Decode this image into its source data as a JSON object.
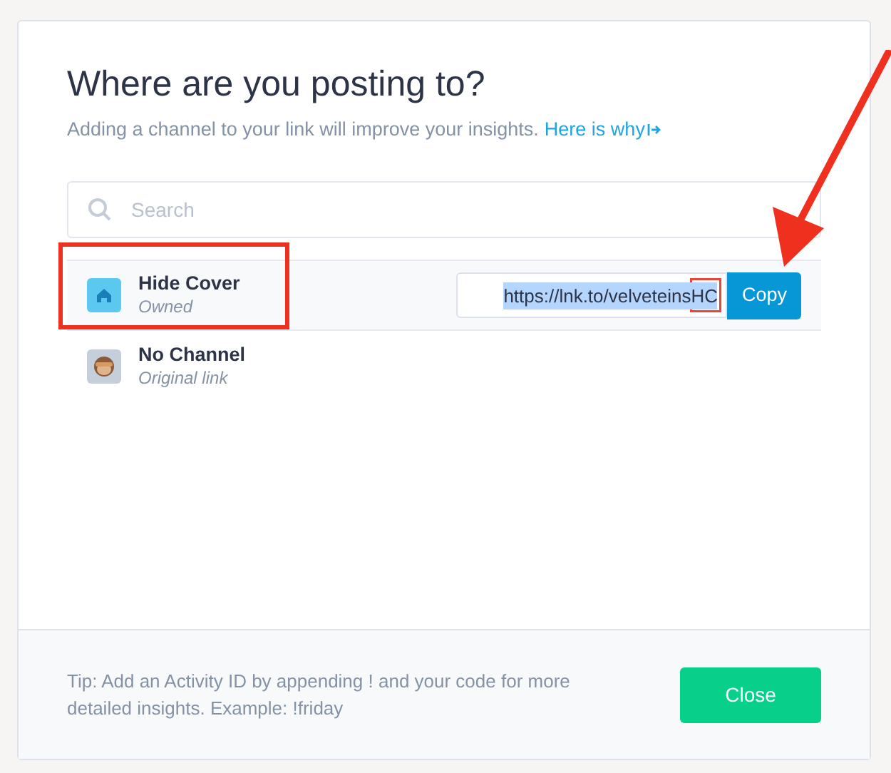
{
  "dialog": {
    "title": "Where are you posting to?",
    "subtitle": "Adding a channel to your link will improve your insights.",
    "help_link": "Here is why"
  },
  "search": {
    "placeholder": "Search"
  },
  "channels": [
    {
      "name": "Hide Cover",
      "detail": "Owned",
      "kind": "house",
      "selected": true,
      "link": "https://lnk.to/velveteinsHC",
      "copy_label": "Copy"
    },
    {
      "name": "No Channel",
      "detail": "Original link",
      "kind": "monkey",
      "selected": false
    }
  ],
  "footer": {
    "tip": "Tip: Add an Activity ID by appending ! and your code for more detailed insights. Example: !friday",
    "close_label": "Close"
  }
}
